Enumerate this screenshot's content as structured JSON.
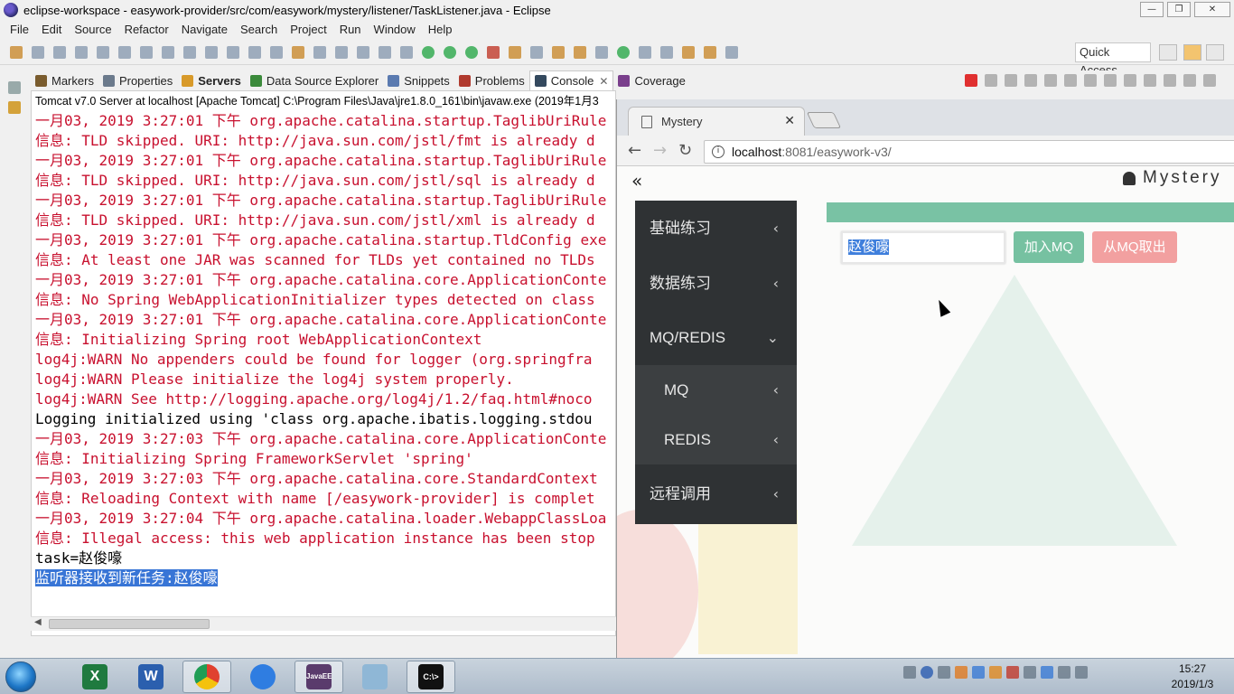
{
  "window": {
    "title": "eclipse-workspace - easywork-provider/src/com/easywork/mystery/listener/TaskListener.java - Eclipse",
    "buttons": [
      "—",
      "❐",
      "✕"
    ]
  },
  "menu": [
    "File",
    "Edit",
    "Source",
    "Refactor",
    "Navigate",
    "Search",
    "Project",
    "Run",
    "Window",
    "Help"
  ],
  "toolbar": {
    "quick_access": "Quick Access"
  },
  "view_tabs": [
    {
      "label": "Markers",
      "icon": "markers-icon",
      "color": "#7a5c2e"
    },
    {
      "label": "Properties",
      "icon": "properties-icon",
      "color": "#6b7a8c"
    },
    {
      "label": "Servers",
      "icon": "servers-icon",
      "color": "#d89a2a",
      "bold": true
    },
    {
      "label": "Data Source Explorer",
      "icon": "datasource-icon",
      "color": "#3b8a3b"
    },
    {
      "label": "Snippets",
      "icon": "snippets-icon",
      "color": "#5a7ab0"
    },
    {
      "label": "Problems",
      "icon": "problems-icon",
      "color": "#b03a2e"
    },
    {
      "label": "Console",
      "icon": "console-icon",
      "color": "#34495e",
      "active": true,
      "close": "✕"
    },
    {
      "label": "Coverage",
      "icon": "coverage-icon",
      "color": "#7a3f8c"
    }
  ],
  "console": {
    "header": "Tomcat v7.0 Server at localhost [Apache Tomcat] C:\\Program Files\\Java\\jre1.8.0_161\\bin\\javaw.exe (2019年1月3",
    "lines": [
      {
        "text": "一月03, 2019 3:27:01 下午 org.apache.catalina.startup.TaglibUriRule",
        "color": "red"
      },
      {
        "text": "信息: TLD skipped. URI: http://java.sun.com/jstl/fmt is already d",
        "color": "red"
      },
      {
        "text": "一月03, 2019 3:27:01 下午 org.apache.catalina.startup.TaglibUriRule",
        "color": "red"
      },
      {
        "text": "信息: TLD skipped. URI: http://java.sun.com/jstl/sql is already d",
        "color": "red"
      },
      {
        "text": "一月03, 2019 3:27:01 下午 org.apache.catalina.startup.TaglibUriRule",
        "color": "red"
      },
      {
        "text": "信息: TLD skipped. URI: http://java.sun.com/jstl/xml is already d",
        "color": "red"
      },
      {
        "text": "一月03, 2019 3:27:01 下午 org.apache.catalina.startup.TldConfig exe",
        "color": "red"
      },
      {
        "text": "信息: At least one JAR was scanned for TLDs yet contained no TLDs",
        "color": "red"
      },
      {
        "text": "一月03, 2019 3:27:01 下午 org.apache.catalina.core.ApplicationConte",
        "color": "red"
      },
      {
        "text": "信息: No Spring WebApplicationInitializer types detected on class",
        "color": "red"
      },
      {
        "text": "一月03, 2019 3:27:01 下午 org.apache.catalina.core.ApplicationConte",
        "color": "red"
      },
      {
        "text": "信息: Initializing Spring root WebApplicationContext",
        "color": "red"
      },
      {
        "text": "log4j:WARN No appenders could be found for logger (org.springfra",
        "color": "red"
      },
      {
        "text": "log4j:WARN Please initialize the log4j system properly.",
        "color": "red"
      },
      {
        "text": "log4j:WARN See http://logging.apache.org/log4j/1.2/faq.html#noco",
        "color": "red"
      },
      {
        "text": "Logging initialized using 'class org.apache.ibatis.logging.stdou",
        "color": "black"
      },
      {
        "text": "一月03, 2019 3:27:03 下午 org.apache.catalina.core.ApplicationConte",
        "color": "red"
      },
      {
        "text": "信息: Initializing Spring FrameworkServlet 'spring'",
        "color": "red"
      },
      {
        "text": "一月03, 2019 3:27:03 下午 org.apache.catalina.core.StandardContext",
        "color": "red"
      },
      {
        "text": "信息: Reloading Context with name [/easywork-provider] is complet",
        "color": "red"
      },
      {
        "text": "一月03, 2019 3:27:04 下午 org.apache.catalina.loader.WebappClassLoa",
        "color": "red"
      },
      {
        "text": "信息: Illegal access: this web application instance has been stop",
        "color": "red"
      },
      {
        "text": "task=赵俊嚎",
        "color": "black"
      },
      {
        "text": "监听器接收到新任务:赵俊嚎",
        "color": "black",
        "selected": true
      }
    ],
    "scroll_left_arrow": "◀"
  },
  "browser": {
    "tab_title": "Mystery",
    "tab_close": "✕",
    "nav": {
      "back": "←",
      "forward": "→",
      "reload": "↻"
    },
    "url_host": "localhost",
    "url_path": ":8081/easywork-v3/",
    "info_icon": "i"
  },
  "webpage": {
    "collapse_icon": "«",
    "brand": "Mystery",
    "sidebar": [
      {
        "label": "基础练习",
        "chevron": "‹",
        "sub": false
      },
      {
        "label": "数据练习",
        "chevron": "‹",
        "sub": false
      },
      {
        "label": "MQ/REDIS",
        "chevron": "⌄",
        "sub": false
      },
      {
        "label": "MQ",
        "chevron": "‹",
        "sub": true
      },
      {
        "label": "REDIS",
        "chevron": "‹",
        "sub": true
      },
      {
        "label": "远程调用",
        "chevron": "‹",
        "sub": false
      }
    ],
    "input_value": "赵俊嚎",
    "add_button": "加入MQ",
    "take_button": "从MQ取出",
    "colors": {
      "teal": "#79c2a4",
      "pink": "#f2a0a0",
      "sidebar": "#2f3234"
    }
  },
  "taskbar": {
    "apps": [
      {
        "name": "excel",
        "label": "X",
        "color": "#1f7a3f",
        "icon": "excel-icon"
      },
      {
        "name": "word",
        "label": "W",
        "color": "#2b5fae",
        "icon": "word-icon"
      },
      {
        "name": "chrome",
        "label": "",
        "color": "#e0412f",
        "icon": "chrome-icon",
        "active": true
      },
      {
        "name": "baidu",
        "label": "",
        "color": "#2f7de1",
        "icon": "baidu-netdisk-icon"
      },
      {
        "name": "eclipse",
        "label": "JavaEE",
        "color": "#5a3b6c",
        "icon": "eclipse-icon",
        "active": true
      },
      {
        "name": "notepad",
        "label": "",
        "color": "#8fb7d6",
        "icon": "notepad-icon"
      },
      {
        "name": "cmd",
        "label": "C:\\>",
        "color": "#111111",
        "icon": "cmd-icon",
        "active": true
      }
    ],
    "time": "15:27",
    "date": "2019/1/3"
  }
}
